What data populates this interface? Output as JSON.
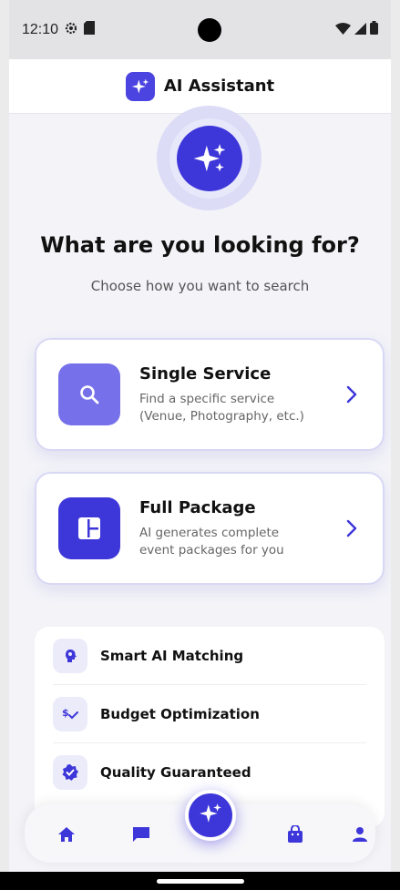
{
  "status_bar": {
    "time": "12:10",
    "left_icons": [
      "settings-gear-icon",
      "sd-card-icon"
    ],
    "right_icons": [
      "wifi-icon",
      "signal-icon",
      "battery-icon"
    ]
  },
  "app_bar": {
    "title": "AI Assistant",
    "logo_icon": "sparkles-icon"
  },
  "hero": {
    "icon": "sparkles-icon"
  },
  "headline": "What are you looking for?",
  "subline": "Choose how you want to search",
  "options": [
    {
      "title": "Single Service",
      "desc_line1": "Find a specific service",
      "desc_line2": "(Venue, Photography, etc.)",
      "icon": "search-icon"
    },
    {
      "title": "Full Package",
      "desc_line1": "AI generates complete",
      "desc_line2": "event packages for you",
      "icon": "dashboard-layout-icon"
    }
  ],
  "features": [
    {
      "label": "Smart AI Matching",
      "icon": "brain-icon"
    },
    {
      "label": "Budget Optimization",
      "icon": "dollar-check-icon"
    },
    {
      "label": "Quality Guaranteed",
      "icon": "verified-badge-icon"
    }
  ],
  "bottom_nav": {
    "items": [
      "home-icon",
      "chat-icon",
      "sparkles-icon",
      "shopping-bag-icon",
      "person-icon"
    ]
  },
  "colors": {
    "accent": "#3d36d9",
    "accent_light": "#7670ea",
    "background": "#f3f3f8"
  }
}
